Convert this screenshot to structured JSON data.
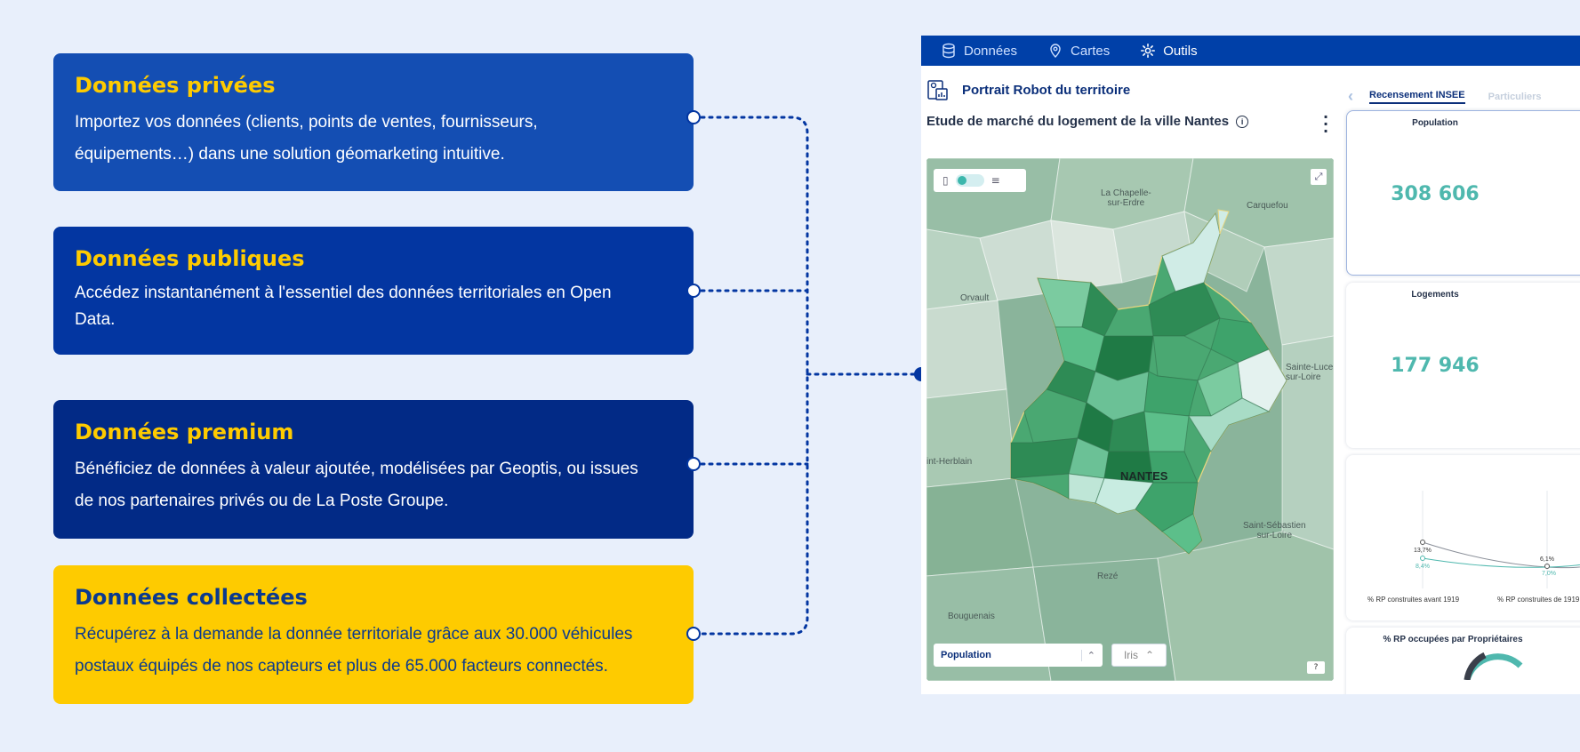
{
  "cards": [
    {
      "title": "Données privées",
      "line1": "Importez vos données (clients, points de ventes, fournisseurs,",
      "line2": "équipements…) dans une solution géomarketing intuitive."
    },
    {
      "title": "Données publiques",
      "line1": "Accédez instantanément à l'essentiel des données territoriales en Open",
      "line2": "Data."
    },
    {
      "title": "Données premium",
      "line1": "Bénéficiez de données à valeur ajoutée, modélisées par Geoptis, ou issues",
      "line2": "de nos partenaires privés ou de La Poste Groupe."
    },
    {
      "title": "Données collectées",
      "line1": "Récupérez à la demande la donnée territoriale grâce aux 30.000 véhicules",
      "line2": "postaux équipés de nos capteurs et plus de 65.000 facteurs connectés."
    }
  ],
  "app": {
    "nav": [
      {
        "label": "Données",
        "icon": "database-icon"
      },
      {
        "label": "Cartes",
        "icon": "map-pin-icon"
      },
      {
        "label": "Outils",
        "icon": "gear-icon"
      }
    ],
    "portrait_title": "Portrait Robot du territoire",
    "tabs": {
      "active": "Recensement INSEE",
      "inactive": "Particuliers"
    },
    "study_title": "Etude de marché du logement de la ville Nantes",
    "map": {
      "labels": {
        "chapelle": "La Chapelle-\nsur-Erdre",
        "carquefou": "Carquefou",
        "orvault": "Orvault",
        "sainte_luce": "Sainte-Luce\nsur-Loire",
        "herblain": "int-Herblain",
        "nantes": "NANTES",
        "sebastien": "Saint-Sébastien\nsur-Loire",
        "reze": "Rezé",
        "bouguenais": "Bouguenais"
      },
      "layer_select": "Population",
      "level_select": "Iris",
      "help": "?"
    },
    "panels": {
      "population": {
        "title": "Population",
        "value": "308 606"
      },
      "logements": {
        "title": "Logements",
        "value": "177 946"
      },
      "chart": {
        "label_a": "% RP construites avant 1919",
        "label_b": "% RP construites de 1919",
        "val_a_top": "13,7%",
        "val_a_bottom": "8,4%",
        "val_b_top": "6,1%",
        "val_b_bottom": "7,0%"
      },
      "proprietaires": {
        "title": "% RP occupées par Propriétaires"
      }
    }
  },
  "colors": {
    "accent_yellow": "#fecb00",
    "navy": "#0040a8",
    "teal": "#4fb8ae"
  }
}
